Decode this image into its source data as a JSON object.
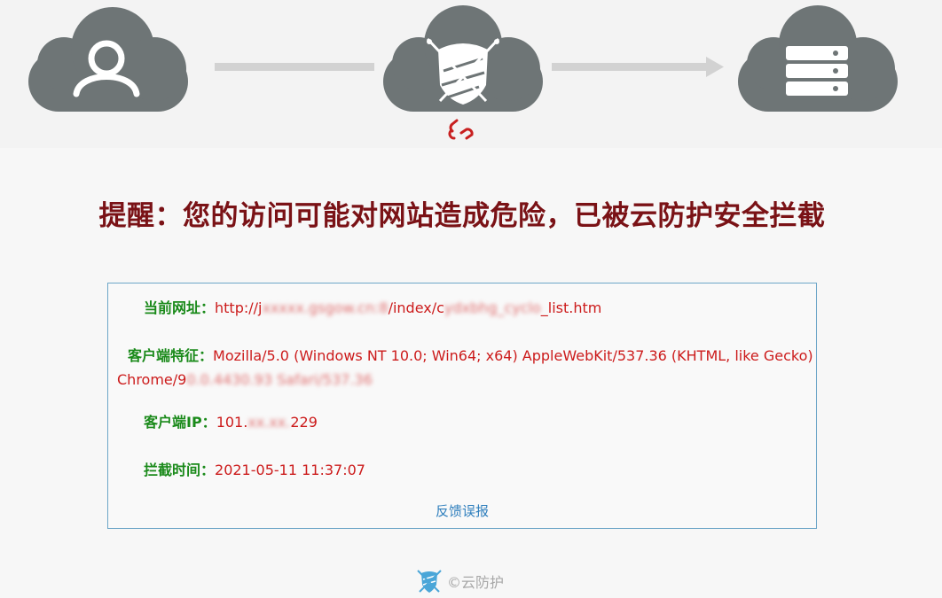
{
  "title": "提醒：您的访问可能对网站造成危险，已被云防护安全拦截",
  "info": {
    "url_label": "当前网址：",
    "url_prefix": "http://j",
    "url_blurred_host": "xxxxx.gsgow.cn:8",
    "url_mid": "/index/c",
    "url_blurred_path": "ydxbhg_cyclo",
    "url_suffix": "_list.htm",
    "ua_label": "客户端特征：",
    "ua_line1": "Mozilla/5.0 (Windows NT 10.0; Win64; x64) AppleWebKit/537.36 (KHTML, like Gecko)",
    "ua_line2_prefix": "Chrome/9",
    "ua_line2_blurred": "0.0.4430.93 Safari/537.36",
    "ip_label": "客户端IP：",
    "ip_prefix": "101.",
    "ip_blurred": "xx.xx.",
    "ip_suffix": "229",
    "time_label": "拦截时间：",
    "time_value": "2021-05-11 11:37:07",
    "feedback": "反馈误报"
  },
  "footer": {
    "brand": "©云防护"
  },
  "icons": {
    "user_cloud": "user-cloud-icon",
    "shield_cloud": "shield-cloud-icon",
    "server_cloud": "server-cloud-icon",
    "broken_link": "broken-link-icon",
    "shield_logo": "shield-logo-icon"
  },
  "colors": {
    "title": "#7a1216",
    "label": "#1a8a1a",
    "value": "#cc1b1b",
    "link": "#2f7fbd",
    "cloud": "#6e7576",
    "box_border": "#6da6c8"
  }
}
